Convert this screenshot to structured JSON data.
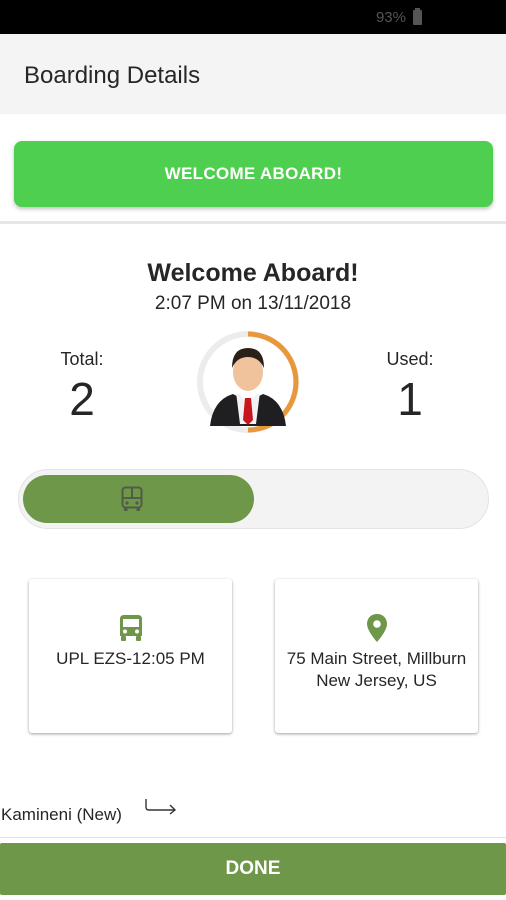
{
  "status_bar": {
    "battery": "93%"
  },
  "app_bar": {
    "title": "Boarding Details"
  },
  "welcome_button": {
    "label": "WELCOME ABOARD!"
  },
  "summary": {
    "heading": "Welcome Aboard!",
    "timestamp": "2:07 PM on 13/11/2018",
    "total_label": "Total:",
    "total_value": "2",
    "used_label": "Used:",
    "used_value": "1"
  },
  "progress": {
    "fraction": 0.5,
    "icon": "bus-icon"
  },
  "cards": {
    "route": {
      "icon": "bus-icon",
      "text": "UPL EZS-12:05 PM"
    },
    "address": {
      "icon": "location-pin-icon",
      "text": "75 Main Street, Millburn New Jersey, US"
    }
  },
  "stop": {
    "label": "Kamineni (New)",
    "icon": "turn-arrow-icon"
  },
  "done_button": {
    "label": "DONE"
  },
  "colors": {
    "welcome_green": "#4fcf4f",
    "olive_green": "#6e974a",
    "avatar_ring": "#e8973a"
  }
}
